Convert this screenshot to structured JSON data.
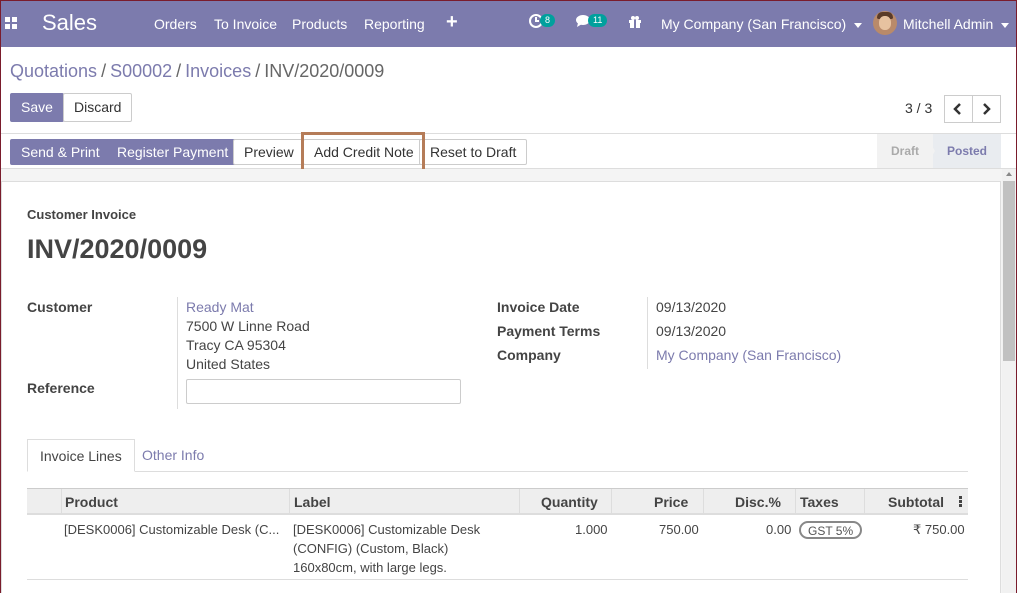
{
  "navbar": {
    "app_name": "Sales",
    "menu": [
      "Orders",
      "To Invoice",
      "Products",
      "Reporting"
    ],
    "plus": "+",
    "activity_count": "8",
    "messages_count": "11",
    "company": "My Company (San Francisco)",
    "user": "Mitchell Admin"
  },
  "breadcrumb": {
    "items": [
      "Quotations",
      "S00002",
      "Invoices"
    ],
    "current": "INV/2020/0009"
  },
  "actions": {
    "save": "Save",
    "discard": "Discard"
  },
  "pager": {
    "value": "3 / 3"
  },
  "statusbar": {
    "buttons": [
      "Send & Print",
      "Register Payment",
      "Preview",
      "Add Credit Note",
      "Reset to Draft"
    ],
    "stages": [
      "Draft",
      "Posted"
    ],
    "active_stage": "Posted"
  },
  "invoice": {
    "type": "Customer Invoice",
    "number": "INV/2020/0009",
    "customer_label": "Customer",
    "customer_name": "Ready Mat",
    "address": [
      "7500 W Linne Road",
      "Tracy CA 95304",
      "United States"
    ],
    "reference_label": "Reference",
    "reference_value": "",
    "invoice_date_label": "Invoice Date",
    "invoice_date": "09/13/2020",
    "payment_terms_label": "Payment Terms",
    "payment_terms": "09/13/2020",
    "company_label": "Company",
    "company": "My Company (San Francisco)"
  },
  "tabs": [
    "Invoice Lines",
    "Other Info"
  ],
  "table": {
    "headers": [
      "Product",
      "Label",
      "Quantity",
      "Price",
      "Disc.%",
      "Taxes",
      "Subtotal"
    ],
    "rows": [
      {
        "product": "[DESK0006] Customizable Desk (C...",
        "label": [
          "[DESK0006] Customizable Desk",
          "(CONFIG) (Custom, Black)",
          "160x80cm, with large legs."
        ],
        "quantity": "1.000",
        "price": "750.00",
        "discount": "0.00",
        "taxes": "GST 5%",
        "subtotal": "₹ 750.00"
      }
    ]
  },
  "colors": {
    "brand": "#7c7bad",
    "highlight": "#b57c58",
    "badge": "#00a09d"
  }
}
